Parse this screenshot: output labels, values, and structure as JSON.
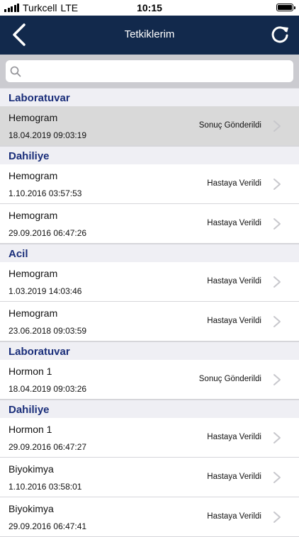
{
  "status_bar": {
    "carrier": "Turkcell",
    "network": "LTE",
    "time": "10:15"
  },
  "header": {
    "title": "Tetkiklerim",
    "back_icon": "chevron-left-icon",
    "refresh_icon": "refresh-icon"
  },
  "search": {
    "placeholder": "",
    "value": ""
  },
  "sections": [
    {
      "header": "Laboratuvar",
      "rows": [
        {
          "title": "Hemogram",
          "date": "18.04.2019 09:03:19",
          "status": "Sonuç Gönderildi",
          "selected": true
        }
      ]
    },
    {
      "header": "Dahiliye",
      "rows": [
        {
          "title": "Hemogram",
          "date": "1.10.2016 03:57:53",
          "status": "Hastaya Verildi"
        },
        {
          "title": "Hemogram",
          "date": "29.09.2016 06:47:26",
          "status": "Hastaya Verildi"
        }
      ]
    },
    {
      "header": "Acil",
      "rows": [
        {
          "title": "Hemogram",
          "date": "1.03.2019 14:03:46",
          "status": "Hastaya Verildi"
        },
        {
          "title": "Hemogram",
          "date": "23.06.2018 09:03:59",
          "status": "Hastaya Verildi"
        }
      ]
    },
    {
      "header": "Laboratuvar",
      "rows": [
        {
          "title": "Hormon 1",
          "date": "18.04.2019 09:03:26",
          "status": "Sonuç Gönderildi"
        }
      ]
    },
    {
      "header": "Dahiliye",
      "rows": [
        {
          "title": "Hormon 1",
          "date": "29.09.2016 06:47:27",
          "status": "Hastaya Verildi"
        },
        {
          "title": "Biyokimya",
          "date": "1.10.2016 03:58:01",
          "status": "Hastaya Verildi"
        },
        {
          "title": "Biyokimya",
          "date": "29.09.2016 06:47:41",
          "status": "Hastaya Verildi"
        }
      ]
    }
  ],
  "colors": {
    "navbar": "#12294c",
    "section_text": "#1a2e7a",
    "selected_row": "#d9d9d9"
  }
}
